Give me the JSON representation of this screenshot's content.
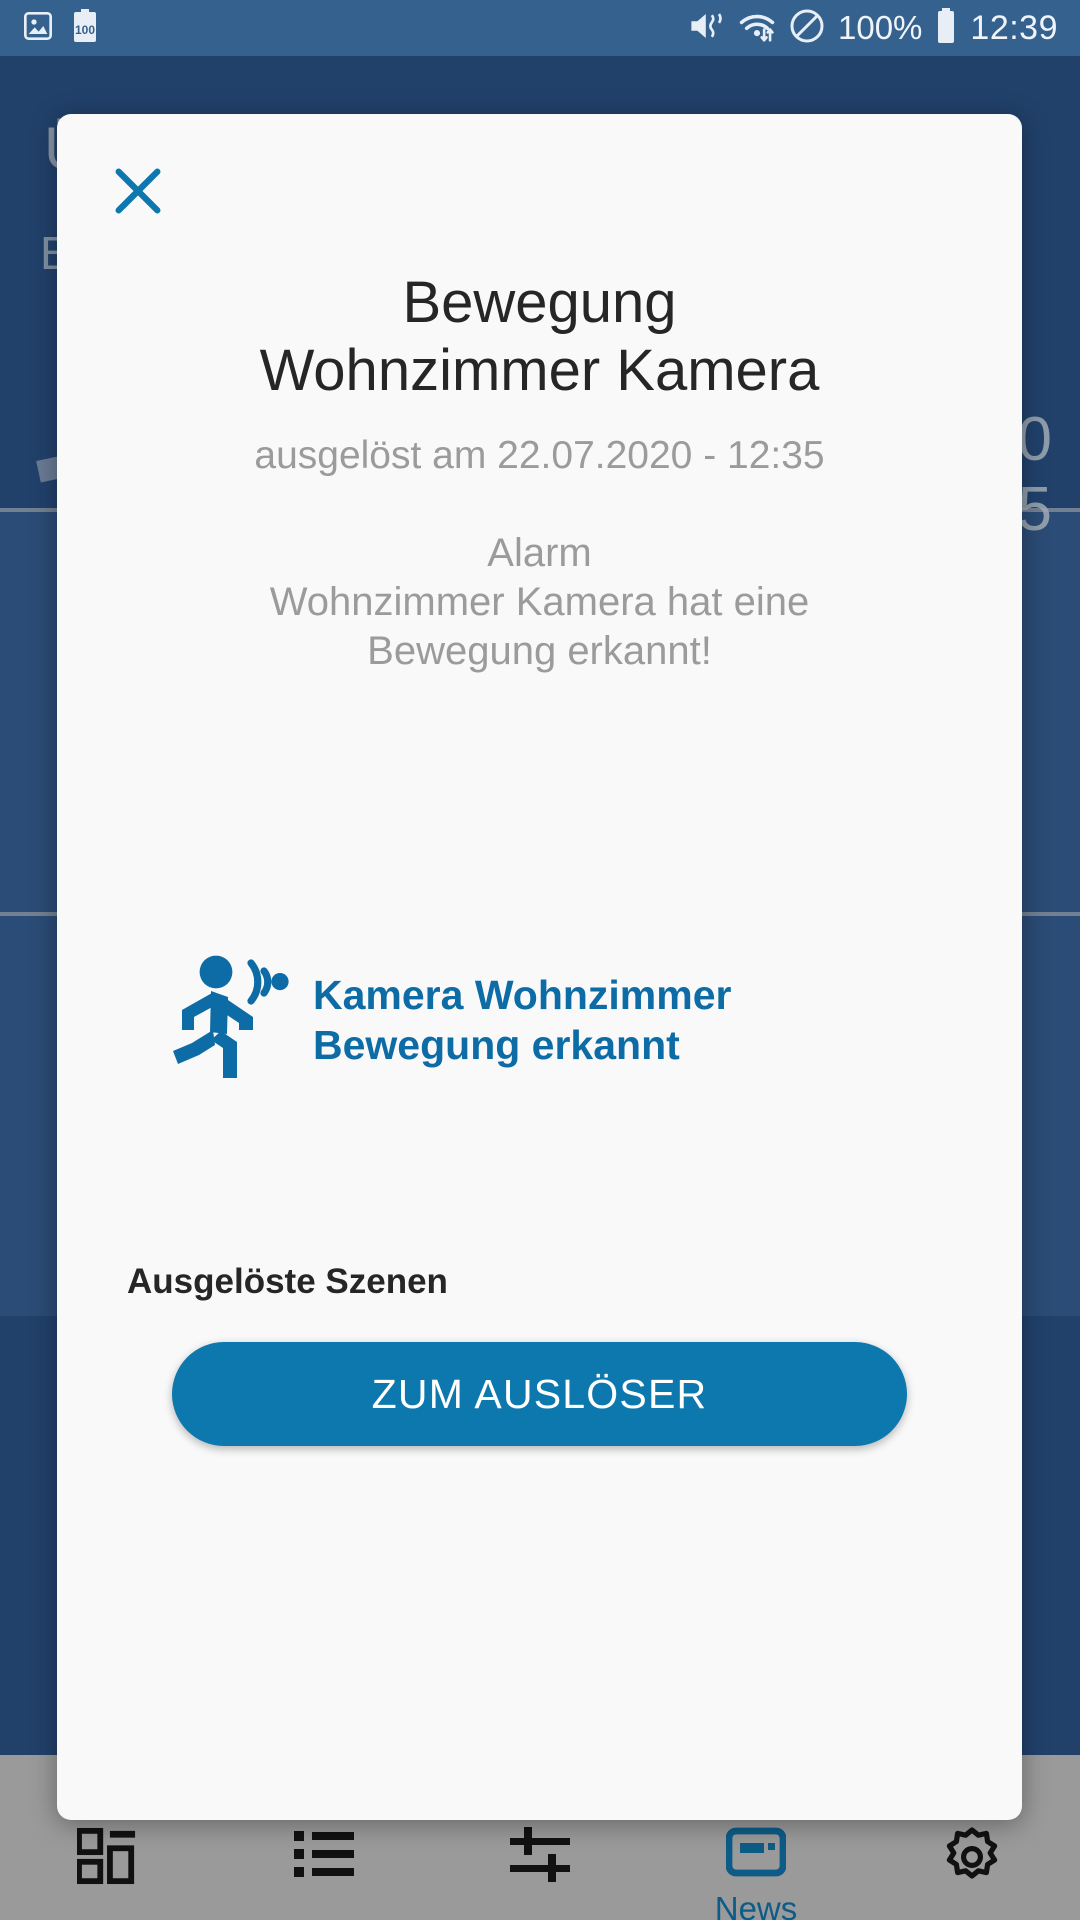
{
  "statusbar": {
    "left_icons": [
      {
        "name": "screenshot-image-icon",
        "glyph": "image"
      },
      {
        "name": "battery-saver-100-icon",
        "glyph": "battery-100",
        "label": "100"
      }
    ],
    "right_icons": [
      {
        "name": "volume-mute-icon",
        "glyph": "mute"
      },
      {
        "name": "wifi-transfer-icon",
        "glyph": "wifi"
      },
      {
        "name": "do-not-disturb-icon",
        "glyph": "dnd"
      }
    ],
    "battery_percent": "100%",
    "battery_icon": "battery-full-icon",
    "time": "12:39",
    "background_color": "#35618f"
  },
  "background_app": {
    "page_title": "Übersicht",
    "section_label": "Benachrichtigungen",
    "number_top": "0",
    "number_bottom": "5",
    "background_color": "#21416b",
    "card_color": "#2b4c76"
  },
  "dialog": {
    "close_icon": "close-icon",
    "title": "Bewegung\nWohnzimmer Kamera",
    "title_line1": "Bewegung",
    "title_line2": "Wohnzimmer Kamera",
    "subtitle": "ausgelöst am 22.07.2020 - 12:35",
    "body_line1": "Alarm",
    "body_line2": "Wohnzimmer Kamera hat eine",
    "body_line3": "Bewegung erkannt!",
    "trigger": {
      "icon": "motion-sensor-running-person-icon",
      "text_line1": "Kamera Wohnzimmer",
      "text_line2": "Bewegung erkannt",
      "color": "#0d6ca5"
    },
    "scenes_label": "Ausgelöste Szenen",
    "cta_label": "ZUM AUSLÖSER",
    "cta_color": "#0d78ae",
    "background_color": "#f9f9fa"
  },
  "bottom_nav": {
    "background_color": "#9a9a9a",
    "active_color": "#0d5c87",
    "items": [
      {
        "name": "nav-dashboard",
        "icon": "dashboard-grid-icon",
        "label": "",
        "active": false
      },
      {
        "name": "nav-list",
        "icon": "list-icon",
        "label": "",
        "active": false
      },
      {
        "name": "nav-controls",
        "icon": "sliders-icon",
        "label": "",
        "active": false
      },
      {
        "name": "nav-news",
        "icon": "news-icon",
        "label": "News",
        "active": true
      },
      {
        "name": "nav-settings",
        "icon": "gear-icon",
        "label": "",
        "active": false
      }
    ]
  }
}
